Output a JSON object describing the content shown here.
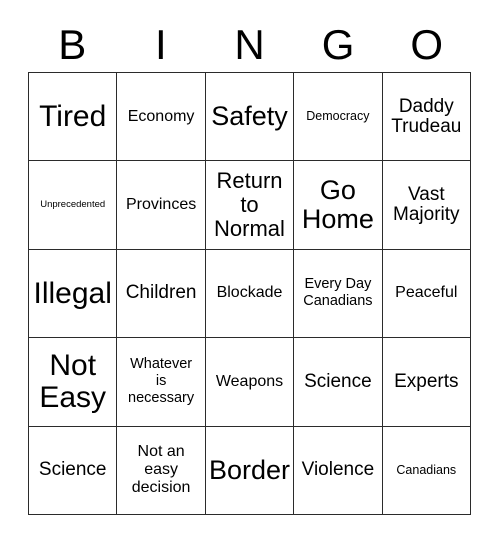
{
  "card": {
    "header_letters": [
      "B",
      "I",
      "N",
      "G",
      "O"
    ],
    "grid": {
      "columns": 5,
      "rows": 5,
      "border_color": "#2b2b2b",
      "background_color": "#ffffff",
      "text_color": "#000000"
    },
    "cells": [
      {
        "text": "Tired",
        "size": "size-xxl"
      },
      {
        "text": "Economy",
        "size": "size-s"
      },
      {
        "text": "Safety",
        "size": "size-xl"
      },
      {
        "text": "Democracy",
        "size": "size-xxs"
      },
      {
        "text": "Daddy\nTrudeau",
        "size": "size-m"
      },
      {
        "text": "Unprecedented",
        "size": "size-tiny"
      },
      {
        "text": "Provinces",
        "size": "size-s"
      },
      {
        "text": "Return\nto\nNormal",
        "size": "size-l"
      },
      {
        "text": "Go\nHome",
        "size": "size-xl"
      },
      {
        "text": "Vast\nMajority",
        "size": "size-m"
      },
      {
        "text": "Illegal",
        "size": "size-xxl"
      },
      {
        "text": "Children",
        "size": "size-m"
      },
      {
        "text": "Blockade",
        "size": "size-s"
      },
      {
        "text": "Every Day\nCanadians",
        "size": "size-xs"
      },
      {
        "text": "Peaceful",
        "size": "size-s"
      },
      {
        "text": "Not\nEasy",
        "size": "size-xxl"
      },
      {
        "text": "Whatever\nis\nnecessary",
        "size": "size-xs"
      },
      {
        "text": "Weapons",
        "size": "size-s"
      },
      {
        "text": "Science",
        "size": "size-m"
      },
      {
        "text": "Experts",
        "size": "size-m"
      },
      {
        "text": "Science",
        "size": "size-m"
      },
      {
        "text": "Not an\neasy\ndecision",
        "size": "size-s"
      },
      {
        "text": "Border",
        "size": "size-xl"
      },
      {
        "text": "Violence",
        "size": "size-m"
      },
      {
        "text": "Canadians",
        "size": "size-xxs"
      }
    ]
  }
}
